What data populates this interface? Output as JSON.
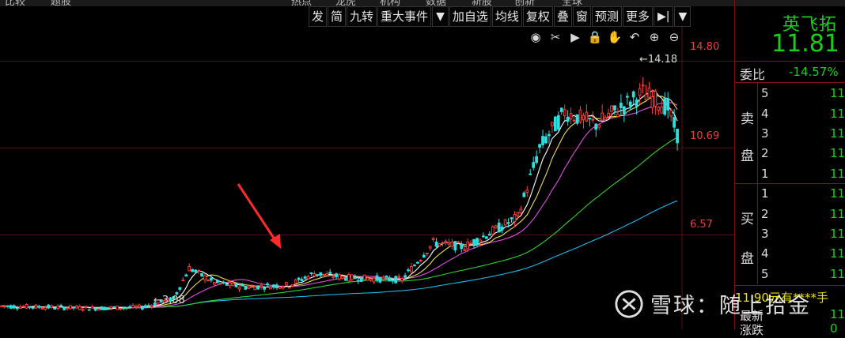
{
  "colors": {
    "up": "#ff3a3a",
    "down": "#2de0e0",
    "ma5": "#ffffff",
    "ma10": "#f0e050",
    "ma20": "#e050e0",
    "ma60": "#30d030",
    "ma120": "#20b8e8",
    "grid": "#5a0f0f",
    "arrow": "#ff2a2a",
    "panel_text": "#18d018"
  },
  "toolbar": {
    "items": [
      "发",
      "简",
      "九转",
      "重大事件",
      "▼",
      "加自选",
      "均线",
      "复权",
      "叠",
      "窗",
      "预测",
      "更多",
      "▶|",
      "▼"
    ]
  },
  "chart_icons": [
    "eye-icon",
    "scissors-icon",
    "play-circle-icon",
    "lock-icon",
    "hand-icon",
    "undo-icon",
    "zoom-in-icon",
    "zoom-out-icon"
  ],
  "chart_icon_glyphs": [
    "◉",
    "✂",
    "▶",
    "🔒",
    "✋",
    "↶",
    "⊕",
    "⊖"
  ],
  "y_axis": {
    "labels": [
      "14.80",
      "10.69",
      "6.57"
    ]
  },
  "annotations": {
    "high": "←14.18",
    "low": "←3.08"
  },
  "chart_data": {
    "type": "candlestick",
    "y_ticks": [
      14.8,
      10.69,
      6.57
    ],
    "ylim": [
      2.4,
      15.6
    ],
    "high_marker": 14.18,
    "low_marker": 3.08,
    "anchors": [
      [
        0,
        3.2
      ],
      [
        30,
        3.1
      ],
      [
        45,
        3.15
      ],
      [
        55,
        3.55
      ],
      [
        60,
        5.0
      ],
      [
        68,
        4.3
      ],
      [
        78,
        4.1
      ],
      [
        92,
        4.2
      ],
      [
        100,
        4.75
      ],
      [
        110,
        4.55
      ],
      [
        128,
        4.45
      ],
      [
        138,
        6.2
      ],
      [
        148,
        6.0
      ],
      [
        165,
        7.4
      ],
      [
        172,
        10.7
      ],
      [
        180,
        12.4
      ],
      [
        190,
        11.8
      ],
      [
        205,
        13.3
      ],
      [
        213,
        12.6
      ],
      [
        216,
        11.3
      ]
    ],
    "series_note": "daily candles from low 3.08 to high 14.18 with MA lines"
  },
  "panel": {
    "stock_name": "英飞拓",
    "price": "11.81",
    "webi_label": "委比",
    "webi_value": "-14.57%",
    "sell_label": "卖",
    "sell_label2": "盘",
    "buy_label": "买",
    "buy_label2": "盘",
    "sell_levels": [
      "5",
      "4",
      "3",
      "2",
      "1"
    ],
    "buy_levels": [
      "1",
      "2",
      "3",
      "4",
      "5"
    ],
    "level_value": "11",
    "order_note": "11.90元有****手",
    "last_label": "最新",
    "last_value": "11",
    "change_label": "涨跌",
    "change_value": "0"
  },
  "watermark": {
    "text": "雪球：随上拾金"
  }
}
